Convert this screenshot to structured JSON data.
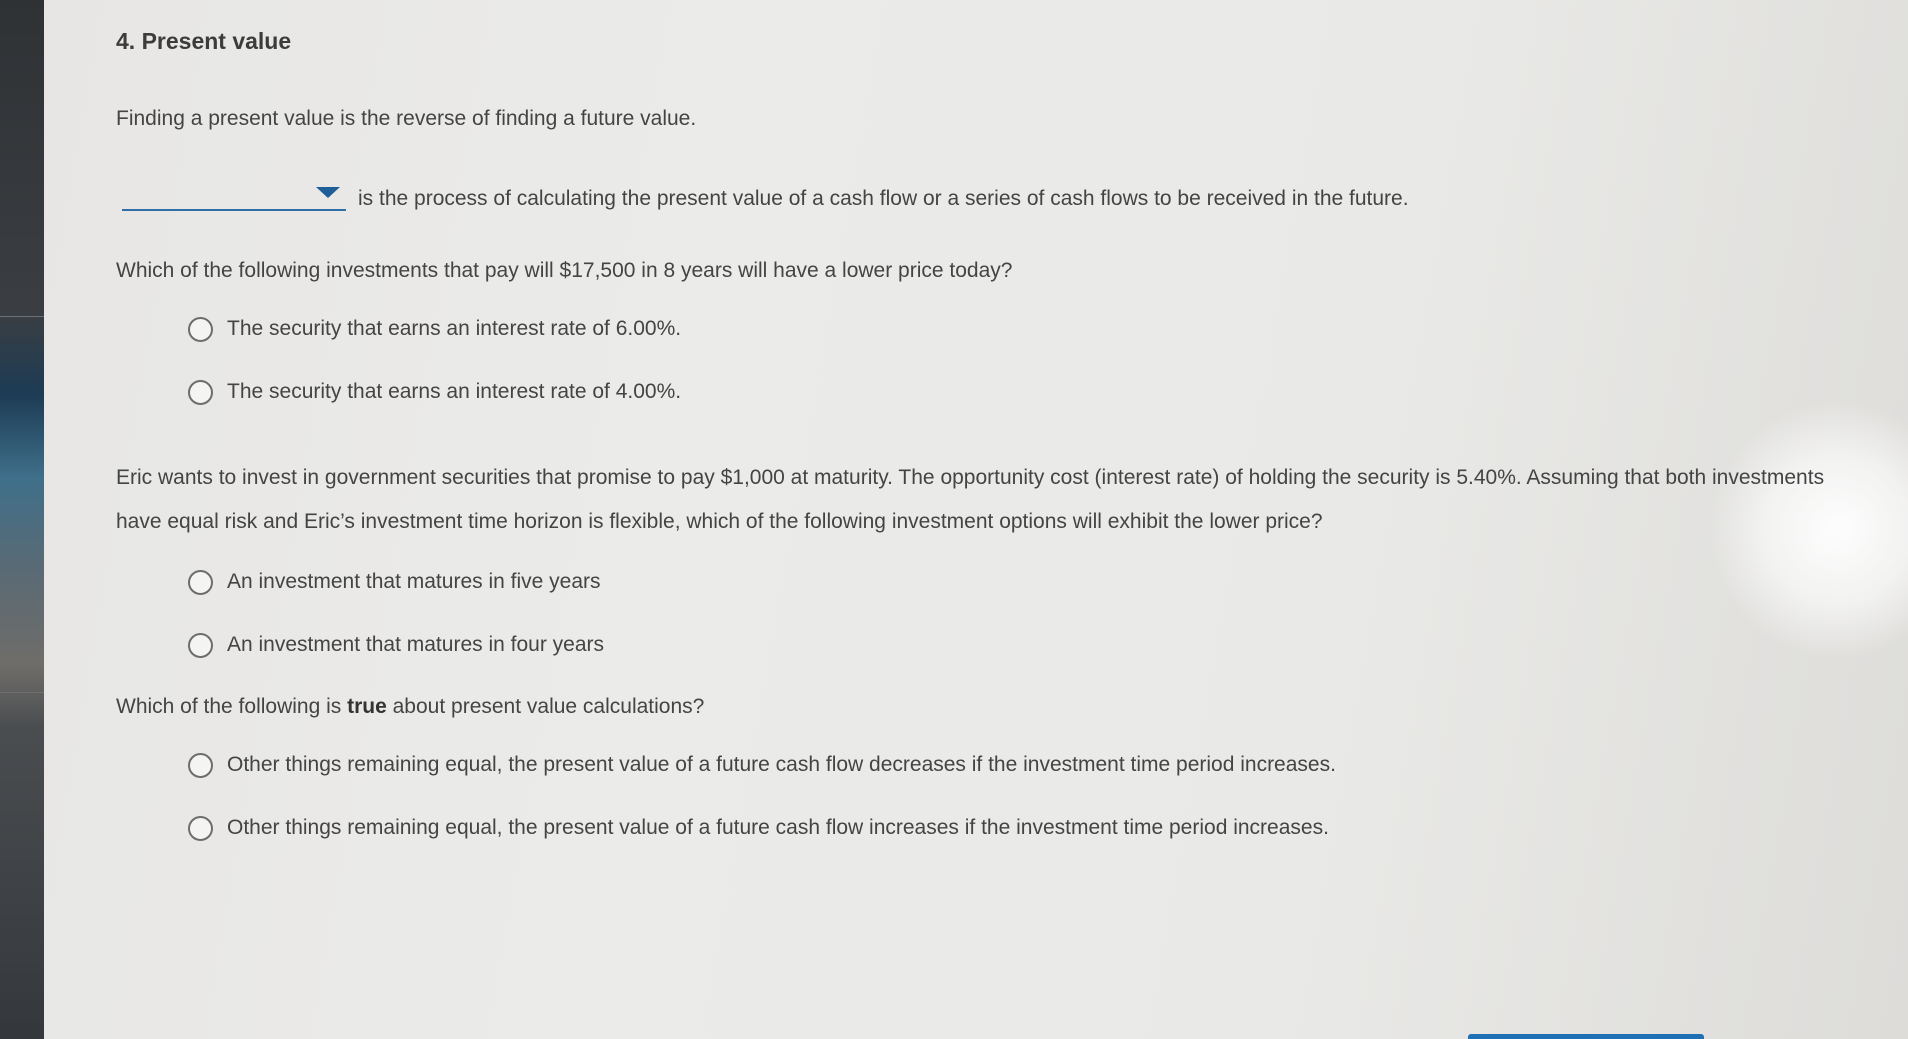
{
  "title": "4. Present value",
  "intro": "Finding a present value is the reverse of finding a future value.",
  "dropdown": {
    "selected": "",
    "trailing_text": "is the process of calculating the present value of a cash flow or a series of cash flows to be received in the future."
  },
  "q1": {
    "question": "Which of the following investments that pay will $17,500 in 8 years will have a lower price today?",
    "options": [
      "The security that earns an interest rate of 6.00%.",
      "The security that earns an interest rate of 4.00%."
    ]
  },
  "q2": {
    "question": "Eric wants to invest in government securities that promise to pay $1,000 at maturity. The opportunity cost (interest rate) of holding the security is 5.40%. Assuming that both investments have equal risk and Eric’s investment time horizon is flexible, which of the following investment options will exhibit the lower price?",
    "options": [
      "An investment that matures in five years",
      "An investment that matures in four years"
    ]
  },
  "q3": {
    "question_prefix": "Which of the following is ",
    "question_bold": "true",
    "question_suffix": " about present value calculations?",
    "options": [
      "Other things remaining equal, the present value of a future cash flow decreases if the investment time period increases.",
      "Other things remaining equal, the present value of a future cash flow increases if the investment time period increases."
    ]
  },
  "colors": {
    "accent": "#1f5e98",
    "text": "#444444"
  }
}
